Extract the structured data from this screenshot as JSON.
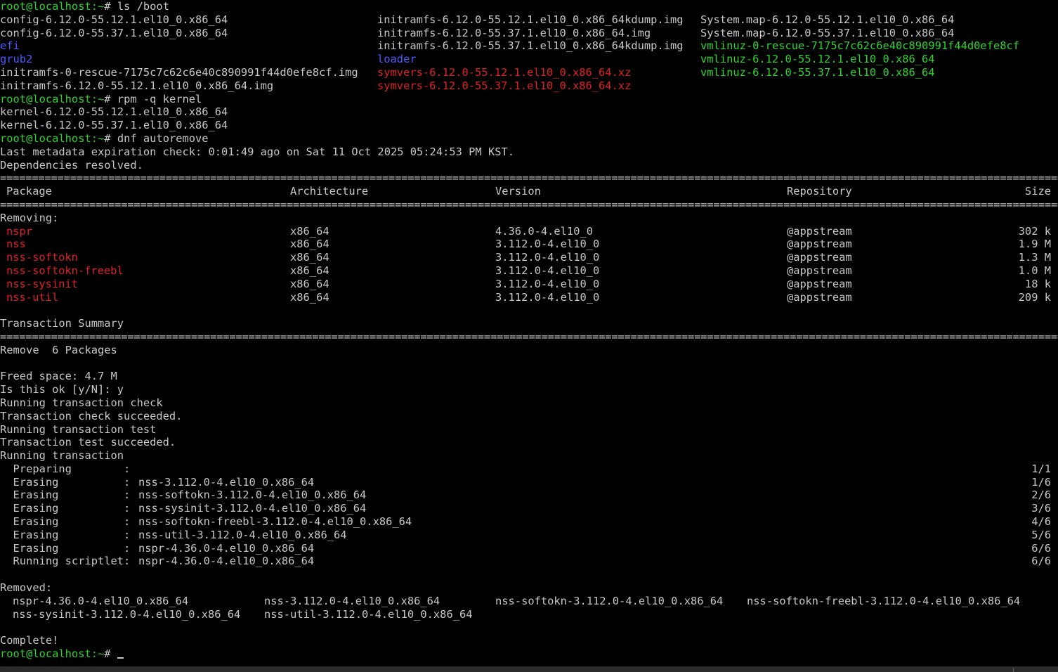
{
  "prompt": {
    "host": "root@localhost",
    "path": ":~",
    "symbol": "# "
  },
  "commands": {
    "ls": "ls /boot",
    "rpm": "rpm -q kernel",
    "dnf": "dnf autoremove"
  },
  "ls_boot": {
    "col1": [
      {
        "text": "config-6.12.0-55.12.1.el10_0.x86_64",
        "color": "plain"
      },
      {
        "text": "config-6.12.0-55.37.1.el10_0.x86_64",
        "color": "plain"
      },
      {
        "text": "efi",
        "color": "blue"
      },
      {
        "text": "grub2",
        "color": "blue"
      },
      {
        "text": "initramfs-0-rescue-7175c7c62c6e40c890991f44d0efe8cf.img",
        "color": "plain"
      },
      {
        "text": "initramfs-6.12.0-55.12.1.el10_0.x86_64.img",
        "color": "plain"
      }
    ],
    "col2": [
      {
        "text": "initramfs-6.12.0-55.12.1.el10_0.x86_64kdump.img",
        "color": "plain"
      },
      {
        "text": "initramfs-6.12.0-55.37.1.el10_0.x86_64.img",
        "color": "plain"
      },
      {
        "text": "initramfs-6.12.0-55.37.1.el10_0.x86_64kdump.img",
        "color": "plain"
      },
      {
        "text": "loader",
        "color": "blue"
      },
      {
        "text": "symvers-6.12.0-55.12.1.el10_0.x86_64.xz",
        "color": "red"
      },
      {
        "text": "symvers-6.12.0-55.37.1.el10_0.x86_64.xz",
        "color": "red"
      }
    ],
    "col3": [
      {
        "text": "System.map-6.12.0-55.12.1.el10_0.x86_64",
        "color": "plain"
      },
      {
        "text": "System.map-6.12.0-55.37.1.el10_0.x86_64",
        "color": "plain"
      },
      {
        "text": "vmlinuz-0-rescue-7175c7c62c6e40c890991f44d0efe8cf",
        "color": "green"
      },
      {
        "text": "vmlinuz-6.12.0-55.12.1.el10_0.x86_64",
        "color": "green"
      },
      {
        "text": "vmlinuz-6.12.0-55.37.1.el10_0.x86_64",
        "color": "green"
      }
    ]
  },
  "rpm_output": [
    "kernel-6.12.0-55.12.1.el10_0.x86_64",
    "kernel-6.12.0-55.37.1.el10_0.x86_64"
  ],
  "dnf": {
    "metadata_line": "Last metadata expiration check: 0:01:49 ago on Sat 11 Oct 2025 05:24:53 PM KST.",
    "deps_line": "Dependencies resolved.",
    "rule_char": "=",
    "table_headers": {
      "package": "Package",
      "arch": "Architecture",
      "version": "Version",
      "repo": "Repository",
      "size": "Size"
    },
    "removing_label": "Removing:",
    "packages": [
      {
        "name": "nspr",
        "arch": "x86_64",
        "version": "4.36.0-4.el10_0",
        "repo": "@appstream",
        "size": "302 k"
      },
      {
        "name": "nss",
        "arch": "x86_64",
        "version": "3.112.0-4.el10_0",
        "repo": "@appstream",
        "size": "1.9 M"
      },
      {
        "name": "nss-softokn",
        "arch": "x86_64",
        "version": "3.112.0-4.el10_0",
        "repo": "@appstream",
        "size": "1.3 M"
      },
      {
        "name": "nss-softokn-freebl",
        "arch": "x86_64",
        "version": "3.112.0-4.el10_0",
        "repo": "@appstream",
        "size": "1.0 M"
      },
      {
        "name": "nss-sysinit",
        "arch": "x86_64",
        "version": "3.112.0-4.el10_0",
        "repo": "@appstream",
        "size": "18 k"
      },
      {
        "name": "nss-util",
        "arch": "x86_64",
        "version": "3.112.0-4.el10_0",
        "repo": "@appstream",
        "size": "209 k"
      }
    ],
    "summary_label": "Transaction Summary",
    "remove_line": "Remove  6 Packages",
    "freed_space": "Freed space: 4.7 M",
    "confirm_line": "Is this ok [y/N]: y",
    "progress_lines": [
      "Running transaction check",
      "Transaction check succeeded.",
      "Running transaction test",
      "Transaction test succeeded.",
      "Running transaction"
    ],
    "steps": [
      {
        "action": "  Preparing        :",
        "target": "",
        "count": "1/1"
      },
      {
        "action": "  Erasing          :",
        "target": "nss-3.112.0-4.el10_0.x86_64",
        "count": "1/6"
      },
      {
        "action": "  Erasing          :",
        "target": "nss-softokn-3.112.0-4.el10_0.x86_64",
        "count": "2/6"
      },
      {
        "action": "  Erasing          :",
        "target": "nss-sysinit-3.112.0-4.el10_0.x86_64",
        "count": "3/6"
      },
      {
        "action": "  Erasing          :",
        "target": "nss-softokn-freebl-3.112.0-4.el10_0.x86_64",
        "count": "4/6"
      },
      {
        "action": "  Erasing          :",
        "target": "nss-util-3.112.0-4.el10_0.x86_64",
        "count": "5/6"
      },
      {
        "action": "  Erasing          :",
        "target": "nspr-4.36.0-4.el10_0.x86_64",
        "count": "6/6"
      },
      {
        "action": "  Running scriptlet:",
        "target": "nspr-4.36.0-4.el10_0.x86_64",
        "count": "6/6"
      }
    ],
    "removed_label": "Removed:",
    "removed_rows": [
      [
        "nspr-4.36.0-4.el10_0.x86_64",
        "nss-3.112.0-4.el10_0.x86_64",
        "nss-softokn-3.112.0-4.el10_0.x86_64",
        "nss-softokn-freebl-3.112.0-4.el10_0.x86_64"
      ],
      [
        "nss-sysinit-3.112.0-4.el10_0.x86_64",
        "nss-util-3.112.0-4.el10_0.x86_64"
      ]
    ],
    "complete_line": "Complete!"
  },
  "colors": {
    "background": "#000000",
    "text": "#c7c7c7",
    "prompt": "#2dd42d",
    "directory": "#4b5bff",
    "archive": "#e02020",
    "executable": "#2dd42d",
    "removed_package": "#e02020"
  }
}
